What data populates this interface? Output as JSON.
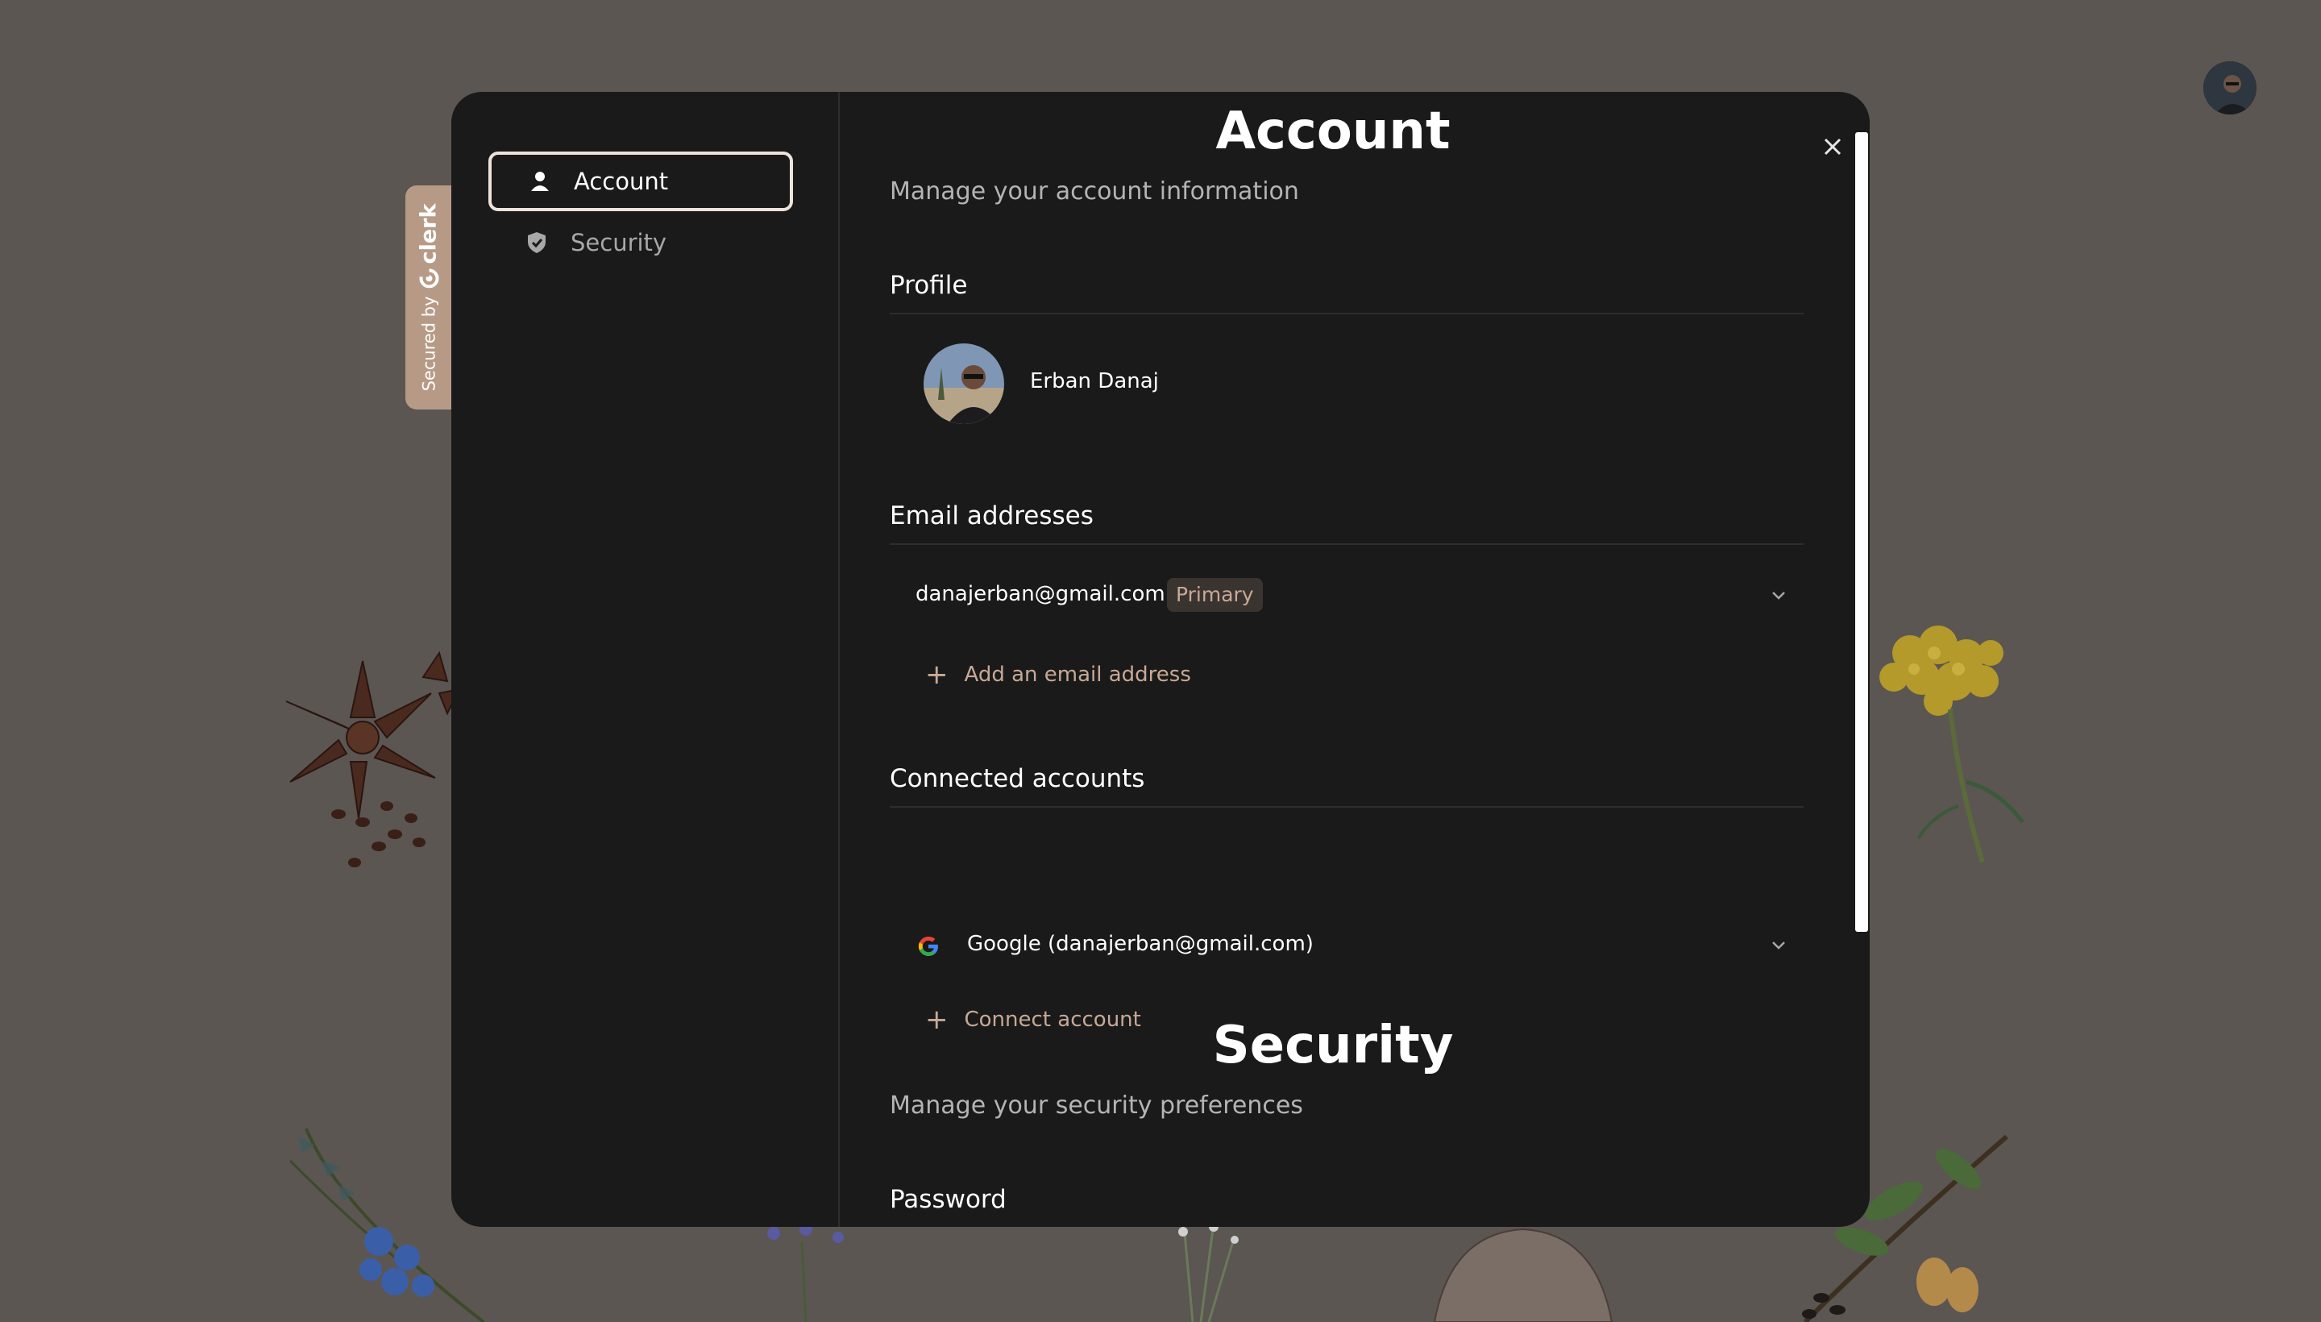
{
  "sidebar": {
    "items": [
      {
        "label": "Account",
        "icon": "user-icon",
        "active": true
      },
      {
        "label": "Security",
        "icon": "shield-icon",
        "active": false
      }
    ]
  },
  "clerk_badge": {
    "secured_by": "Secured by",
    "brand": "clerk"
  },
  "account": {
    "title": "Account",
    "subtitle": "Manage your account information",
    "profile": {
      "section_title": "Profile",
      "name": "Erban Danaj"
    },
    "emails": {
      "section_title": "Email addresses",
      "items": [
        {
          "address": "danajerban@gmail.com",
          "badge": "Primary"
        }
      ],
      "add_label": "Add an email address"
    },
    "connected": {
      "section_title": "Connected accounts",
      "items": [
        {
          "provider": "Google",
          "label": "Google (danajerban@gmail.com)",
          "icon": "google-icon"
        }
      ],
      "add_label": "Connect account"
    }
  },
  "security": {
    "title": "Security",
    "subtitle": "Manage your security preferences",
    "password_title": "Password"
  },
  "colors": {
    "backdrop": "#5b5652",
    "modal": "#1a1a1a",
    "accent": "#c8a996",
    "clerk_tab": "#b79a86"
  }
}
